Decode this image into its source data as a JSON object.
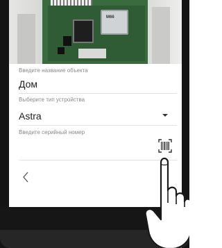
{
  "photo": {
    "module_label": "M66"
  },
  "form": {
    "object_name": {
      "label": "Введите название объекта",
      "value": "Дом"
    },
    "device_type": {
      "label": "Выберите тип устройства",
      "value": "Astra"
    },
    "serial": {
      "label": "Введите серийный номер",
      "value": ""
    }
  },
  "icons": {
    "dropdown": "chevron-down-icon",
    "scan": "barcode-scan-icon",
    "back": "chevron-left-icon",
    "hand": "pointing-hand-icon"
  },
  "colors": {
    "frame": "#141414",
    "label": "#8a8a8a",
    "text": "#1f1f1f"
  }
}
